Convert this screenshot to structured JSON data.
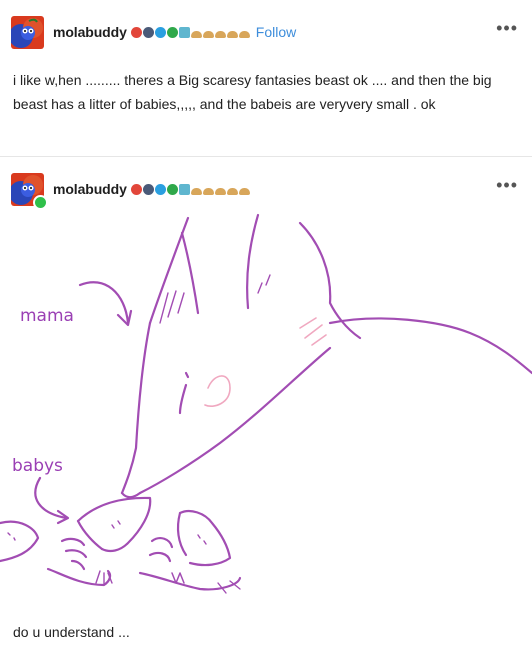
{
  "post1": {
    "username": "molabuddy",
    "follow_label": "Follow",
    "more_label": "•••",
    "body": "i like w,hen ......... theres a Big scaresy fantasies beast ok .... and then the big beast has a litter of babies,,,,, and the babeis are veryvery small . ok"
  },
  "post2": {
    "username": "molabuddy",
    "more_label": "•••",
    "drawing": {
      "label_mama": "mama",
      "label_babys": "babys"
    },
    "caption": "do u understand ..."
  },
  "colors": {
    "accent": "#3d8ddb",
    "line_purple": "#a24db3",
    "blush_pink": "#f0a8c0",
    "label_purple": "#9a3fb4"
  },
  "icons": [
    "avatar-pikmin-icon",
    "badge-icons",
    "more-options-icon"
  ]
}
